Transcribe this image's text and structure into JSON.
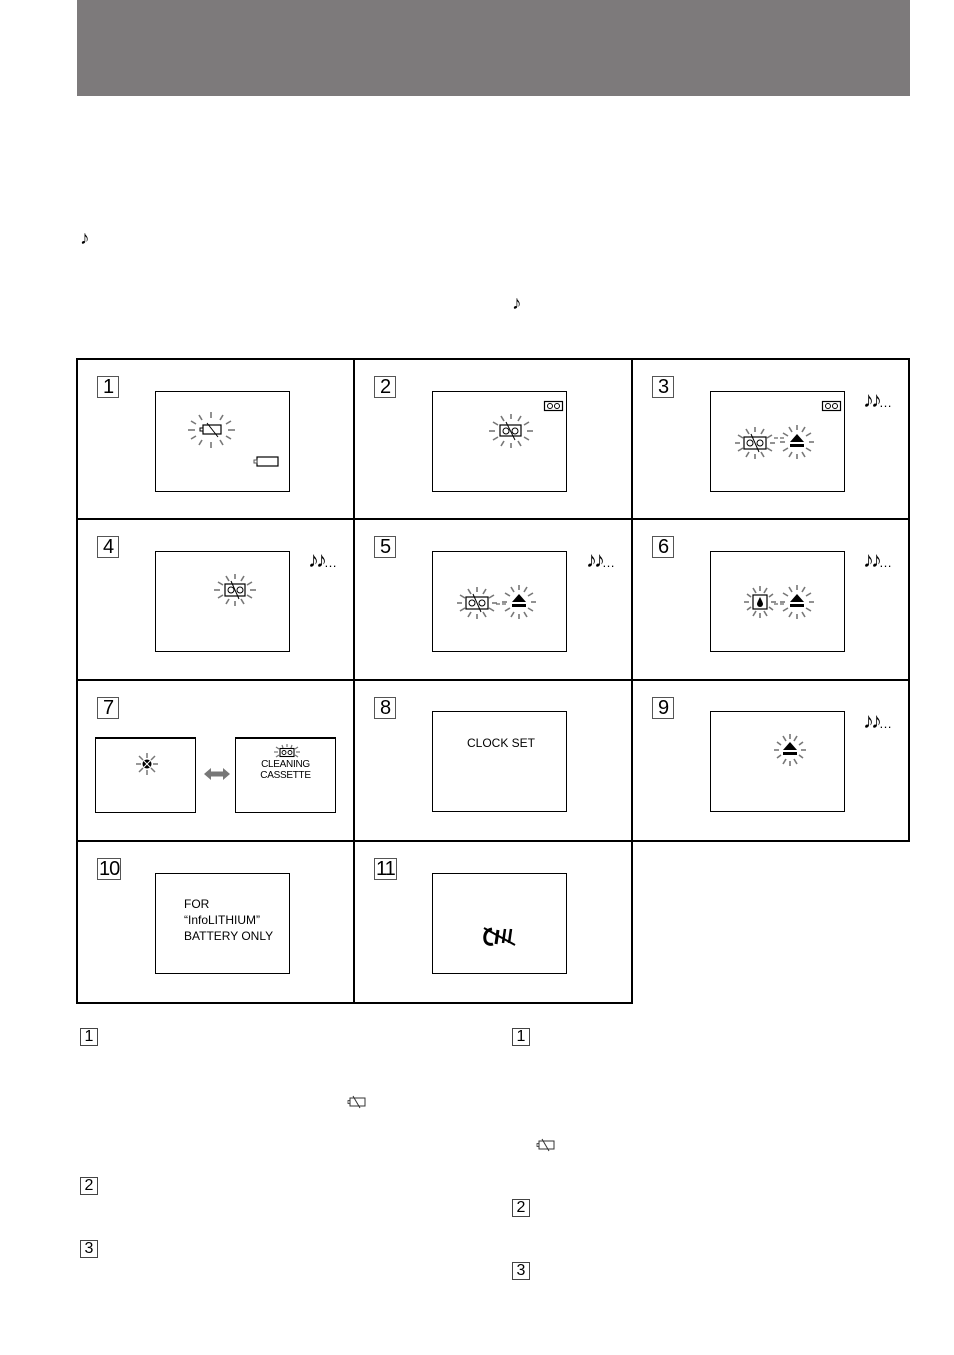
{
  "page": {
    "header_band_color": "#7d7a7b",
    "intro": {
      "note_icons": [
        {
          "name": "single-beep-icon",
          "glyph": "♪"
        },
        {
          "name": "single-beep-icon",
          "glyph": "♪"
        }
      ]
    },
    "indicator_grid": {
      "cells": [
        {
          "number": "1",
          "label": "battery-low",
          "beep": null,
          "icons": [
            "blinking-battery-empty-icon",
            "battery-icon"
          ]
        },
        {
          "number": "2",
          "label": "cassette-ending",
          "beep": null,
          "icons": [
            "blinking-cassette-icon",
            "cassette-icon"
          ]
        },
        {
          "number": "3",
          "label": "cassette-ended",
          "beep": "♪♪",
          "icons": [
            "blinking-cassette-icon",
            "blinking-eject-icon",
            "cassette-icon"
          ]
        },
        {
          "number": "4",
          "label": "no-cassette",
          "beep": "♪♪",
          "icons": [
            "blinking-cassette-icon"
          ]
        },
        {
          "number": "5",
          "label": "tab-out",
          "beep": "♪♪",
          "icons": [
            "blinking-cassette-icon",
            "blinking-eject-icon"
          ]
        },
        {
          "number": "6",
          "label": "moisture-condensation",
          "beep": "♪♪",
          "icons": [
            "blinking-moisture-icon",
            "blinking-eject-icon"
          ]
        },
        {
          "number": "7",
          "label": "dirty-heads",
          "beep": null,
          "icons": [
            "blinking-head-dirt-icon",
            "blinking-cassette-icon"
          ],
          "alt_screen_text": [
            "CLEANING",
            "CASSETTE"
          ]
        },
        {
          "number": "8",
          "label": "clock-not-set",
          "beep": null,
          "screen_text": "CLOCK SET"
        },
        {
          "number": "9",
          "label": "eject-fault",
          "beep": "♪♪",
          "icons": [
            "blinking-eject-icon"
          ]
        },
        {
          "number": "10",
          "label": "wrong-battery",
          "beep": null,
          "screen_text": [
            "FOR",
            "“InfoLITHIUM”",
            "BATTERY ONLY"
          ]
        },
        {
          "number": "11",
          "label": "chip-warning",
          "beep": null,
          "icons": [
            "crossed-chip-icon"
          ]
        }
      ],
      "beep_suffix": "…"
    },
    "descriptions": {
      "left_column": [
        {
          "marker": "1",
          "inline_icon": "battery-empty-icon"
        },
        {
          "marker": "2"
        },
        {
          "marker": "3"
        }
      ],
      "right_column": [
        {
          "marker": "1",
          "inline_icon": "battery-empty-icon"
        },
        {
          "marker": "2"
        },
        {
          "marker": "3"
        }
      ]
    }
  }
}
